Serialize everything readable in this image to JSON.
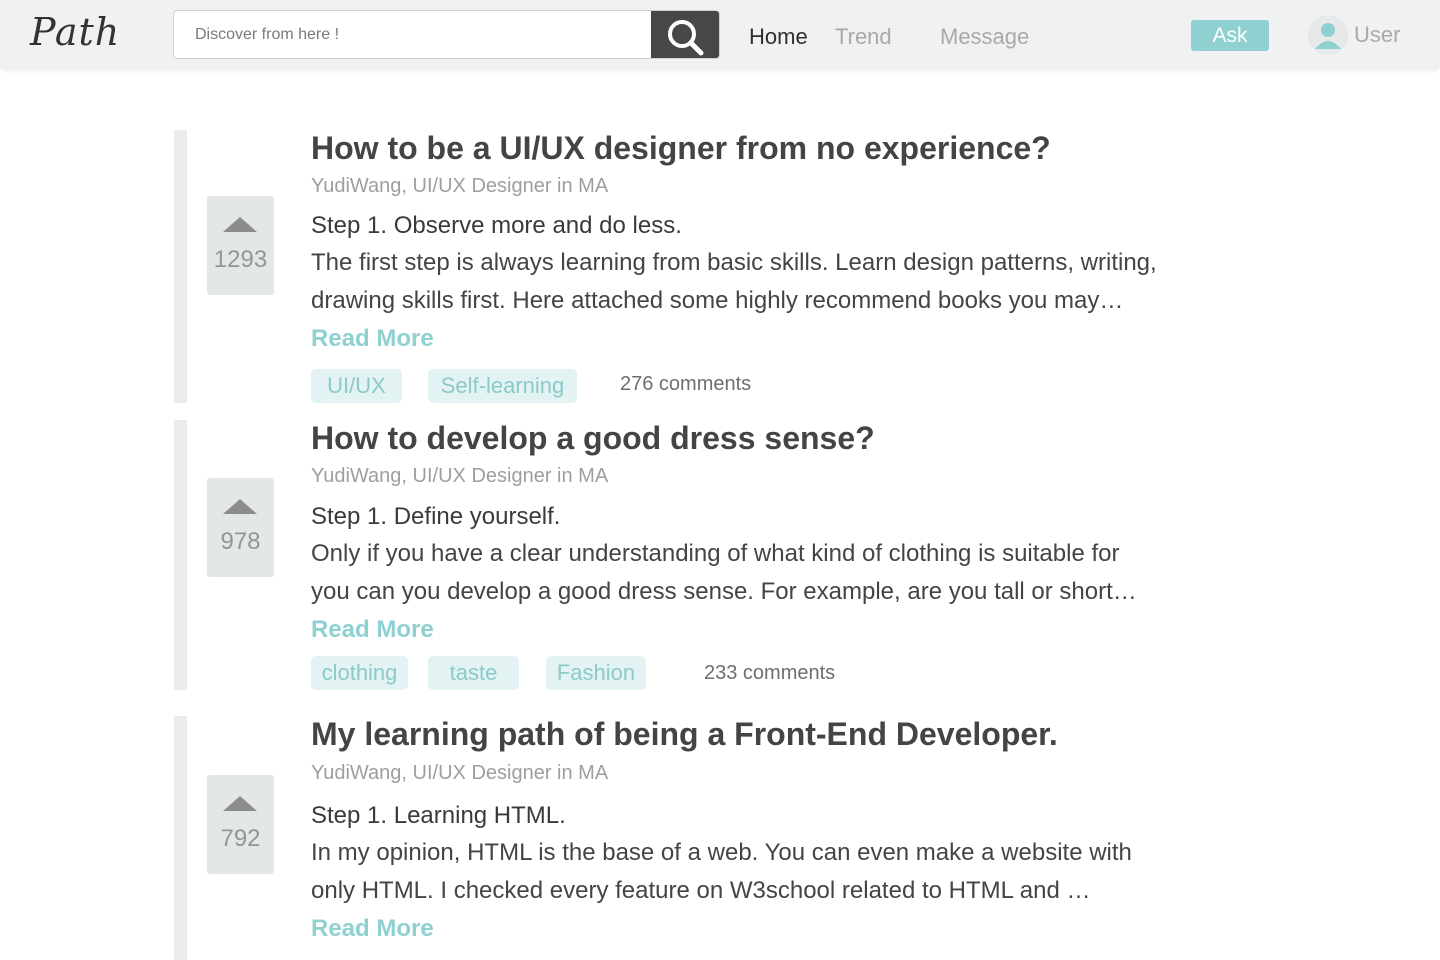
{
  "header": {
    "logo": "Path",
    "search": {
      "placeholder": "Discover from here !",
      "value": ""
    },
    "nav": {
      "home": "Home",
      "trend": "Trend",
      "message": "Message"
    },
    "ask_label": "Ask",
    "user_label": "User"
  },
  "posts": [
    {
      "votes": "1293",
      "title": "How to be a UI/UX designer from no experience?",
      "author": "YudiWang, UI/UX Designer in MA",
      "step": "Step 1. Observe more and do less.",
      "excerpt_line1": "The first step is always learning from basic skills. Learn design patterns, writing,",
      "excerpt_line2": "drawing skills first. Here attached some highly recommend books you may…",
      "read_more": "Read More",
      "tags": [
        "UI/UX",
        "Self-learning"
      ],
      "comments": "276 comments"
    },
    {
      "votes": "978",
      "title": "How to develop a good dress sense?",
      "author": "YudiWang, UI/UX Designer in MA",
      "step": "Step 1. Define yourself.",
      "excerpt_line1": "Only if you have a clear understanding of what kind of clothing is suitable for",
      "excerpt_line2": "you can you develop a good dress sense. For example, are you tall or short…",
      "read_more": "Read More",
      "tags": [
        "clothing",
        "taste",
        "Fashion"
      ],
      "comments": "233 comments"
    },
    {
      "votes": "792",
      "title": "My learning path of being a Front-End Developer.",
      "author": "YudiWang, UI/UX Designer in MA",
      "step": "Step 1. Learning HTML.",
      "excerpt_line1": "In my opinion, HTML is the base of a web. You can even make a website with",
      "excerpt_line2": "only HTML. I checked every feature on W3school related to HTML and …",
      "read_more": "Read More"
    }
  ],
  "colors": {
    "accent": "#8fd0d0",
    "tag_bg": "#e3f3f3",
    "search_button": "#474747",
    "header_bg": "#f0f1f2"
  },
  "icons": [
    "search-icon",
    "upvote-icon",
    "user-avatar-icon"
  ]
}
